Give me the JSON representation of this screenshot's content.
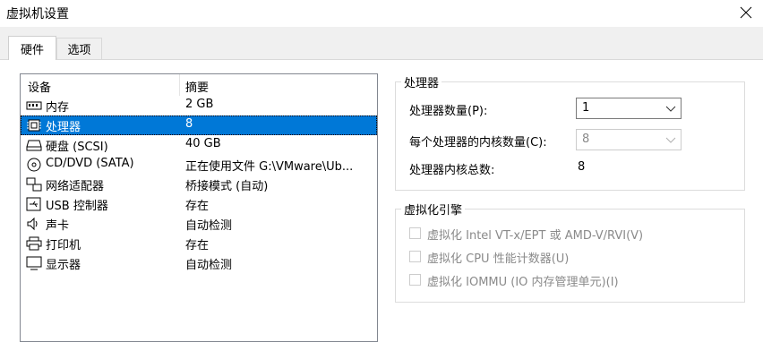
{
  "window": {
    "title": "虚拟机设置"
  },
  "tabs": [
    {
      "label": "硬件"
    },
    {
      "label": "选项"
    }
  ],
  "device_list": {
    "headers": {
      "device": "设备",
      "summary": "摘要"
    },
    "rows": [
      {
        "name": "内存",
        "summary": "2 GB",
        "icon": "memory-icon"
      },
      {
        "name": "处理器",
        "summary": "8",
        "icon": "processor-icon",
        "selected": true
      },
      {
        "name": "硬盘 (SCSI)",
        "summary": "40 GB",
        "icon": "hard-disk-icon"
      },
      {
        "name": "CD/DVD (SATA)",
        "summary": "正在使用文件 G:\\VMware\\Ub...",
        "icon": "cd-dvd-icon"
      },
      {
        "name": "网络适配器",
        "summary": "桥接模式 (自动)",
        "icon": "network-adapter-icon"
      },
      {
        "name": "USB 控制器",
        "summary": "存在",
        "icon": "usb-controller-icon"
      },
      {
        "name": "声卡",
        "summary": "自动检测",
        "icon": "sound-card-icon"
      },
      {
        "name": "打印机",
        "summary": "存在",
        "icon": "printer-icon"
      },
      {
        "name": "显示器",
        "summary": "自动检测",
        "icon": "display-icon"
      }
    ]
  },
  "processor_group": {
    "legend": "处理器",
    "count_label": "处理器数量(P):",
    "count_value": "1",
    "cores_label": "每个处理器的内核数量(C):",
    "cores_value": "8",
    "total_label": "处理器内核总数:",
    "total_value": "8"
  },
  "virtualization_group": {
    "legend": "虚拟化引擎",
    "options": [
      {
        "label": "虚拟化 Intel VT-x/EPT 或 AMD-V/RVI(V)",
        "checked": false,
        "enabled": false
      },
      {
        "label": "虚拟化 CPU 性能计数器(U)",
        "checked": false,
        "enabled": false
      },
      {
        "label": "虚拟化 IOMMU (IO 内存管理单元)(I)",
        "checked": false,
        "enabled": false
      }
    ]
  },
  "colors": {
    "selection": "#0078d7",
    "disabled_text": "#8a8a8a"
  }
}
